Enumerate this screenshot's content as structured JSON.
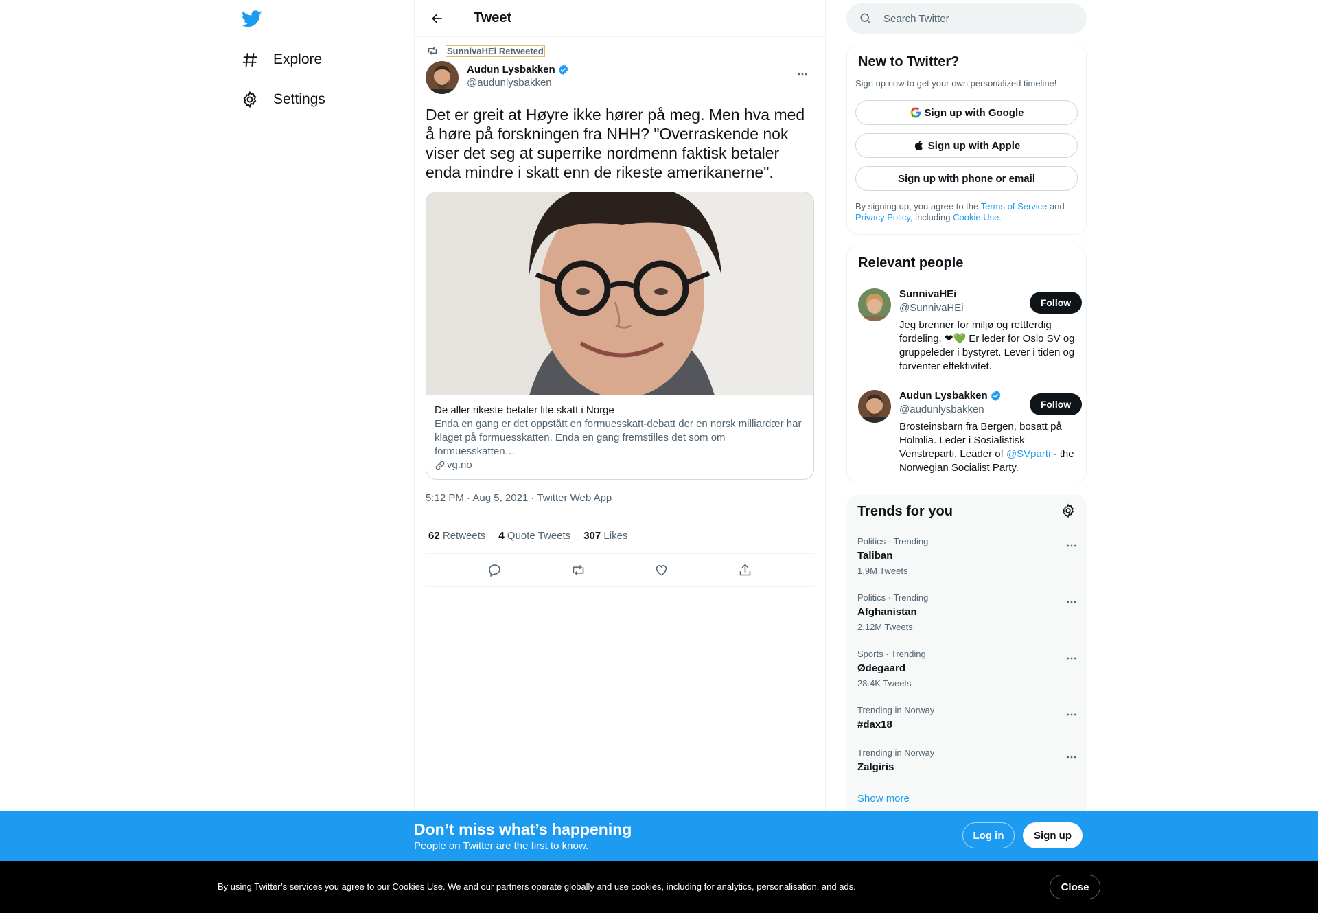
{
  "nav": {
    "explore_label": "Explore",
    "settings_label": "Settings"
  },
  "header": {
    "title": "Tweet"
  },
  "tweet": {
    "retweeted_by": "SunnivaHEi Retweeted",
    "author_name": "Audun Lysbakken",
    "author_handle": "@audunlysbakken",
    "text": "Det er greit at Høyre ikke hører på meg. Men hva med å høre på forskningen fra NHH? \"Overraskende nok viser det seg at superrike nordmenn faktisk betaler enda mindre i skatt enn de rikeste amerikanerne\".",
    "card": {
      "title": "De aller rikeste betaler lite skatt i Norge",
      "description": "Enda en gang er det oppstått en formuesskatt-debatt der en norsk milliardær har klaget på formuesskatten. Enda en gang fremstilles det som om formuesskatten…",
      "domain": "vg.no"
    },
    "meta": "5:12 PM · Aug 5, 2021 · Twitter Web App",
    "stats": [
      {
        "count": "62",
        "label": "Retweets"
      },
      {
        "count": "4",
        "label": "Quote Tweets"
      },
      {
        "count": "307",
        "label": "Likes"
      }
    ]
  },
  "search": {
    "placeholder": "Search Twitter"
  },
  "new_to_twitter": {
    "title": "New to Twitter?",
    "subtitle": "Sign up now to get your own personalized timeline!",
    "google_label": "Sign up with Google",
    "apple_label": "Sign up with Apple",
    "phone_label": "Sign up with phone or email",
    "legal_prefix": "By signing up, you agree to the ",
    "terms_link": "Terms of Service",
    "legal_and": " and",
    "privacy_link": "Privacy Policy",
    "legal_including": ", including ",
    "cookie_link": "Cookie Use."
  },
  "relevant_people": {
    "title": "Relevant people",
    "people": [
      {
        "name": "SunnivaHEi",
        "handle": "@SunnivaHEi",
        "bio": "Jeg brenner for miljø og rettferdig fordeling. ❤💚 Er leder for Oslo SV og gruppeleder i bystyret. Lever i tiden og forventer effektivitet.",
        "follow_label": "Follow"
      },
      {
        "name": "Audun Lysbakken",
        "handle": "@audunlysbakken",
        "bio_prefix": "Brosteinsbarn fra Bergen, bosatt på Holmlia. Leder i Sosialistisk Venstreparti. Leader of ",
        "bio_mention": "@SVparti",
        "bio_suffix": " - the Norwegian Socialist Party.",
        "follow_label": "Follow"
      }
    ]
  },
  "trends": {
    "title": "Trends for you",
    "items": [
      {
        "context": "Politics · Trending",
        "name": "Taliban",
        "count": "1.9M Tweets"
      },
      {
        "context": "Politics · Trending",
        "name": "Afghanistan",
        "count": "2.12M Tweets"
      },
      {
        "context": "Sports · Trending",
        "name": "Ødegaard",
        "count": "28.4K Tweets"
      },
      {
        "context": "Trending in Norway",
        "name": "#dax18",
        "count": ""
      },
      {
        "context": "Trending in Norway",
        "name": "Zalgiris",
        "count": ""
      }
    ],
    "show_more": "Show more"
  },
  "banner": {
    "title": "Don’t miss what’s happening",
    "subtitle": "People on Twitter are the first to know.",
    "login_label": "Log in",
    "signup_label": "Sign up"
  },
  "cookie": {
    "text": "By using Twitter’s services you agree to our Cookies Use. We and our partners operate globally and use cookies, including for analytics, personalisation, and ads.",
    "close_label": "Close"
  },
  "colors": {
    "accent": "#1d9bf0",
    "text_primary": "#0f1419",
    "text_secondary": "#536471",
    "border": "#eff3f4"
  }
}
